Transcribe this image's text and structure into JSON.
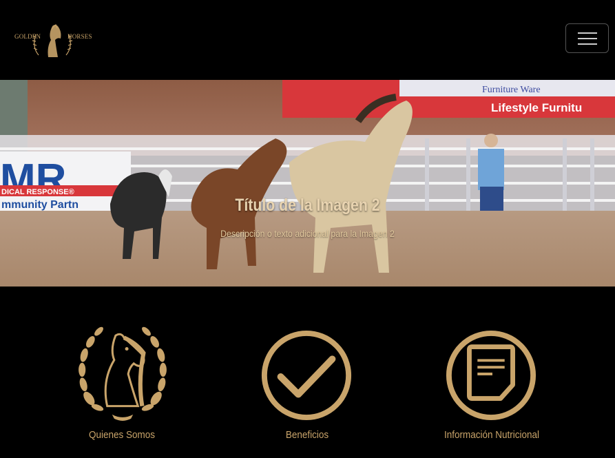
{
  "brand": {
    "logo_text_left": "GOLDEN",
    "logo_text_right": "HORSES",
    "accent_color": "#c9a46a"
  },
  "navbar": {
    "toggler_icon": "hamburger-menu-icon"
  },
  "carousel": {
    "slide_title": "Título de la Imagen 2",
    "slide_description": "Descripción o texto adicional para la Imagen 2",
    "banner_left": "MR",
    "banner_left_sub1": "DICAL RESPONSE®",
    "banner_left_sub2": "mmunity Partn",
    "banner_right_top": "Furniture Ware",
    "banner_right_bottom": "Lifestyle Furnitu"
  },
  "features": [
    {
      "label": "Quienes Somos",
      "icon": "laurel-horse-icon"
    },
    {
      "label": "Beneficios",
      "icon": "check-circle-icon"
    },
    {
      "label": "Información Nutricional",
      "icon": "document-circle-icon"
    }
  ]
}
